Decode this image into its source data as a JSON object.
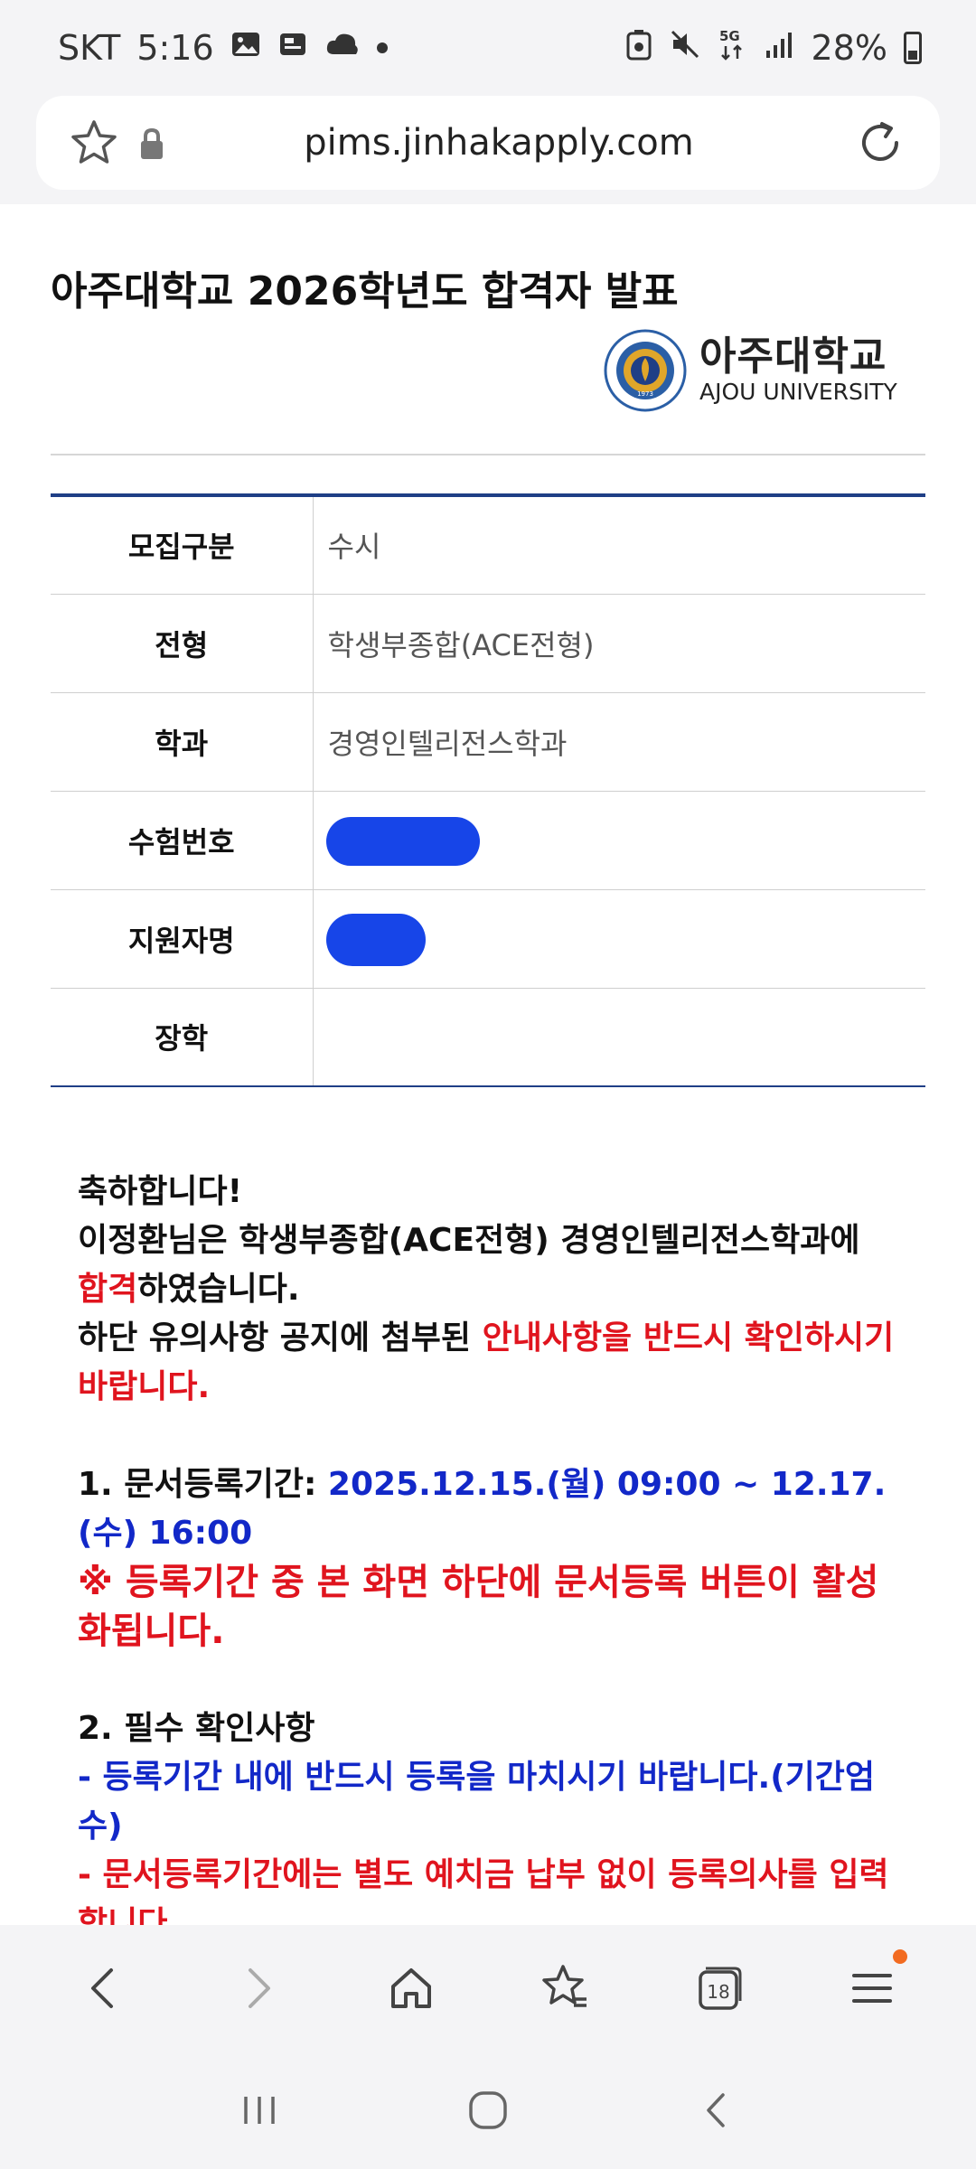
{
  "status_bar": {
    "carrier": "SKT",
    "time": "5:16",
    "battery": "28%",
    "network": "5G"
  },
  "browser": {
    "url": "pims.jinhakapply.com",
    "tab_count": "18"
  },
  "page": {
    "title": "아주대학교 2026학년도 합격자 발표",
    "logo": {
      "korean": "아주대학교",
      "english": "AJOU UNIVERSITY",
      "seal_text": "아주대학교 1973 AJOU UNIVERSITY"
    },
    "table": [
      {
        "label": "모집구분",
        "value": "수시"
      },
      {
        "label": "전형",
        "value": "학생부종합(ACE전형)"
      },
      {
        "label": "학과",
        "value": "경영인텔리전스학과"
      },
      {
        "label": "수험번호",
        "value": ""
      },
      {
        "label": "지원자명",
        "value": ""
      },
      {
        "label": "장학",
        "value": ""
      }
    ],
    "notice": {
      "congrats": "축하합니다!",
      "line1": "이정환님은 학생부종합(ACE전형) 경영인텔리전스학과에",
      "pass_word": "합격",
      "line2_rest": "하였습니다.",
      "line3_prefix": "하단 유의사항 공지에 첨부된 ",
      "line3_red": "안내사항을 반드시 확인하시기 바랍니다.",
      "s1_label": "1. 문서등록기간: ",
      "s1_period": "2025.12.15.(월) 09:00 ~ 12.17.(수) 16:00",
      "s1_note": " ※ 등록기간 중 본 화면 하단에 문서등록 버튼이 활성화됩니다.",
      "s2_label": "2. 필수 확인사항",
      "s2_item1": " - 등록기간 내에 반드시 등록을 마치시기 바랍니다.(기간엄수)",
      "s2_item2": " - 문서등록기간에는 별도 예치금 납부 없이 등록의사를 입력합니다."
    }
  },
  "colors": {
    "table_border": "#1f3f86",
    "red": "#e0141e",
    "blue": "#1228c8",
    "redaction": "#1745e8",
    "badge": "#f26b21"
  },
  "icons": {
    "status_left": [
      "gallery-icon",
      "news-icon",
      "cloud-icon"
    ],
    "status_right": [
      "recycle-icon",
      "mute-icon",
      "signal-icon",
      "battery-icon"
    ],
    "toolbar": [
      "back-icon",
      "forward-icon",
      "home-icon",
      "bookmarks-icon",
      "tabs-icon",
      "menu-icon"
    ],
    "navbar": [
      "recents-icon",
      "home-circle-icon",
      "back-chevron-icon"
    ]
  }
}
